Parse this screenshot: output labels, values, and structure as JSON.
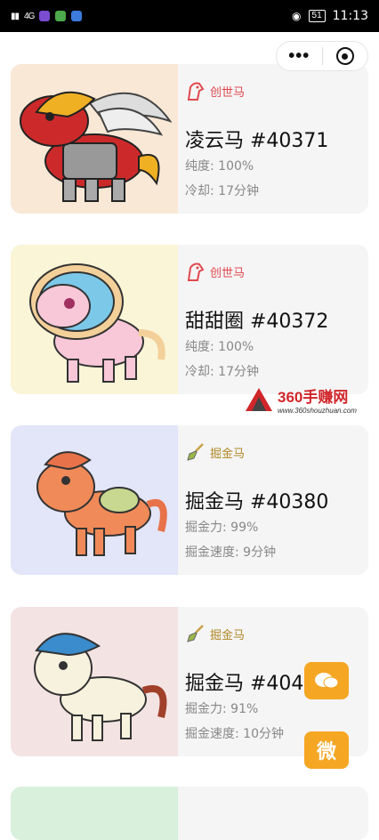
{
  "status_bar": {
    "battery": "51",
    "time": "11:13",
    "signal": "4G"
  },
  "capsule": {
    "more_label": "•••"
  },
  "cards": [
    {
      "tag": "创世马",
      "name": "凌云马 #40371",
      "attr1": "纯度: 100%",
      "attr2": "冷却:  17分钟",
      "bg": "#f9e8d6"
    },
    {
      "tag": "创世马",
      "name": "甜甜圈 #40372",
      "attr1": "纯度: 100%",
      "attr2": "冷却:  17分钟",
      "bg": "#faf5d7"
    },
    {
      "tag": "掘金马",
      "name": "掘金马 #40380",
      "attr1": "掘金力: 99%",
      "attr2": "掘金速度: 9分钟",
      "bg": "#e3e5f8"
    },
    {
      "tag": "掘金马",
      "name": "掘金马 #4046",
      "attr1": "掘金力: 91%",
      "attr2": "掘金速度: 10分钟",
      "bg": "#f4e3e3"
    }
  ],
  "watermark": {
    "title": "360手赚网",
    "url": "www.360shouzhuan.com"
  },
  "badges": {
    "badge1": "",
    "badge2": "微"
  },
  "colors": {
    "genesis": "#e0484f",
    "gold": "#c8a04a"
  }
}
